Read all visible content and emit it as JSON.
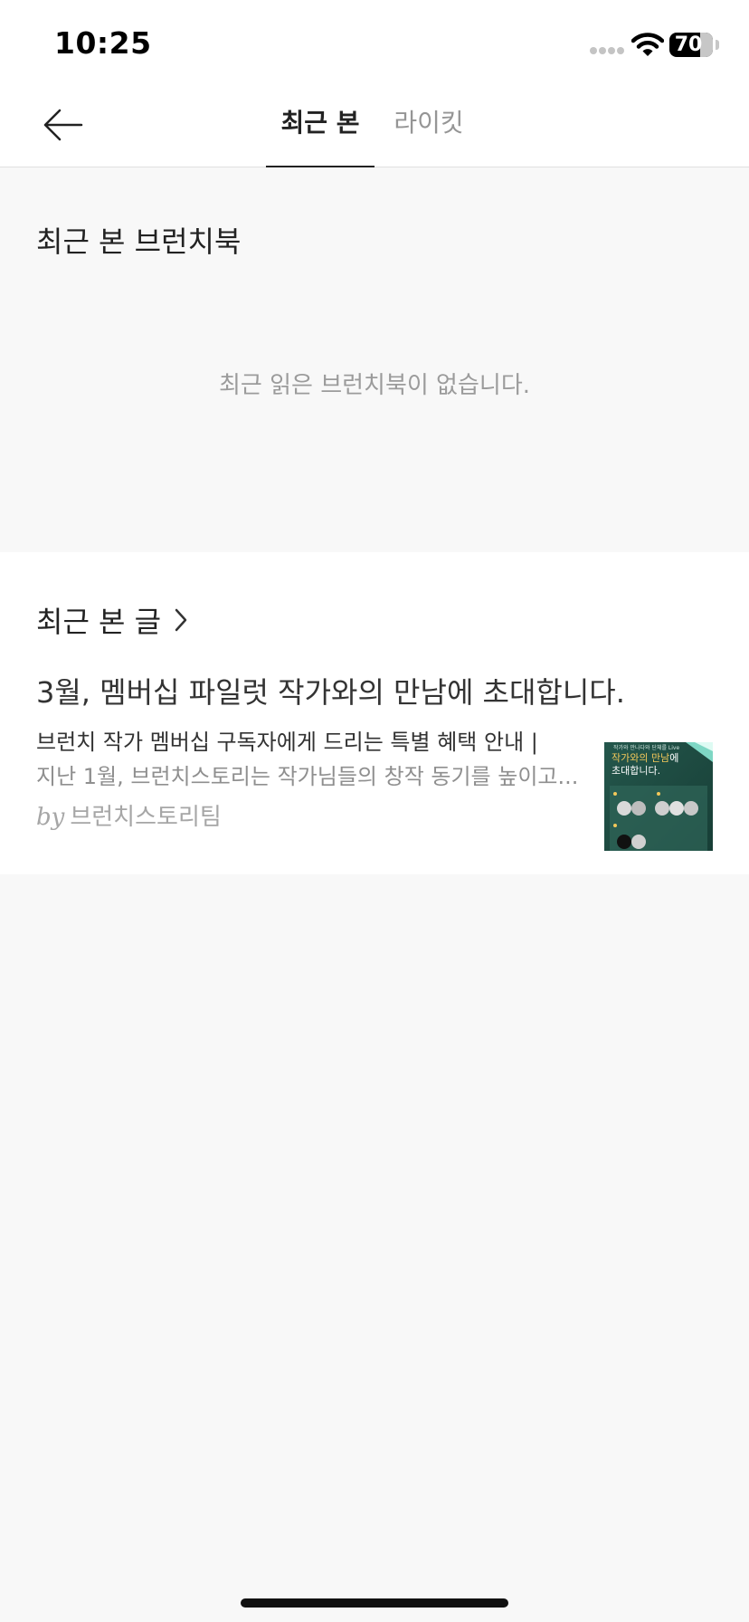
{
  "status_bar": {
    "time": "10:25",
    "battery": "70"
  },
  "nav": {
    "tabs": [
      {
        "label": "최근 본",
        "active": true
      },
      {
        "label": "라이킷",
        "active": false
      }
    ]
  },
  "recent_books": {
    "title": "최근 본 브런치북",
    "empty_message": "최근 읽은 브런치북이 없습니다."
  },
  "recent_posts": {
    "title": "최근 본 글",
    "items": [
      {
        "title": "3월, 멤버십 파일럿 작가와의 만남에 초대합니다.",
        "subtitle": "브런치 작가 멤버십 구독자에게 드리는 특별 혜택 안내 |",
        "description": "지난 1월, 브런치스토리는 작가님들의 창작 동기를 높이고...",
        "by": "by",
        "author": "브런치스토리팀",
        "thumbnail": {
          "top_text": "작가와 만나다와 단체를 Live",
          "headline_1": "작가와의 만남",
          "headline_1_suffix": "에",
          "headline_2": "초대합니다."
        }
      }
    ]
  },
  "colors": {
    "thumb_bg": "#1f4f45",
    "thumb_accent": "#f3c85a",
    "tab_active": "#222222",
    "tab_inactive": "#959595"
  }
}
